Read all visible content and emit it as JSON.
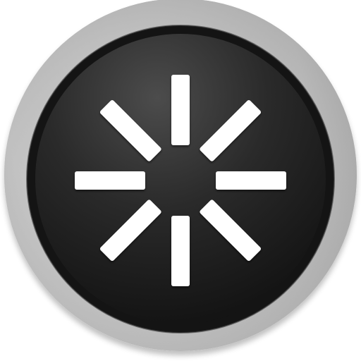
{
  "icon": {
    "name": "restart-icon",
    "spoke_count": 8,
    "colors": {
      "bezel_light": "#f4f4f4",
      "bezel_mid": "#bdbdbd",
      "bezel_dark": "#7a7a7a",
      "rim": "#141414",
      "face_center": "#4a4a4a",
      "face_edge": "#111111",
      "spoke": "#ffffff"
    }
  }
}
